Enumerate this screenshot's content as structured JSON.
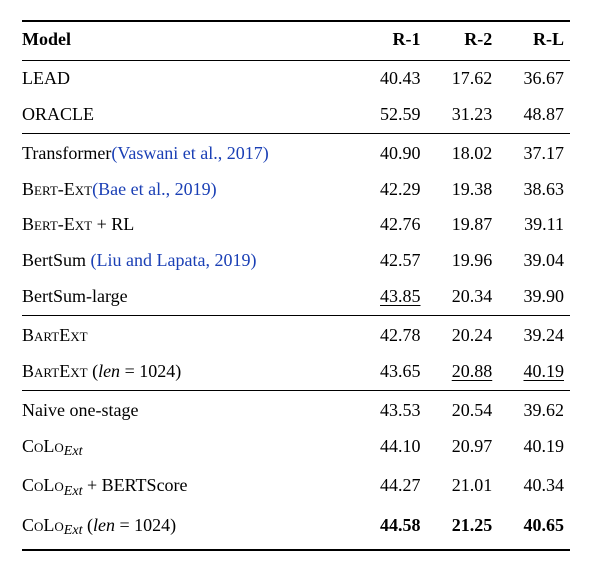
{
  "chart_data": {
    "type": "table",
    "columns": [
      "Model",
      "R-1",
      "R-2",
      "R-L"
    ],
    "sections": [
      {
        "rows": [
          {
            "model_parts": [
              {
                "t": "LEAD"
              }
            ],
            "r1": "40.43",
            "r2": "17.62",
            "rl": "36.67"
          },
          {
            "model_parts": [
              {
                "t": "ORACLE"
              }
            ],
            "r1": "52.59",
            "r2": "31.23",
            "rl": "48.87"
          }
        ]
      },
      {
        "rows": [
          {
            "model_parts": [
              {
                "t": "Transformer"
              },
              {
                "t": "(Vaswani et al., 2017)",
                "cls": "cite"
              }
            ],
            "r1": "40.90",
            "r2": "18.02",
            "rl": "37.17"
          },
          {
            "model_parts": [
              {
                "t": "Bert-Ext",
                "cls": "sc"
              },
              {
                "t": "(Bae et al., 2019)",
                "cls": "cite"
              }
            ],
            "r1": "42.29",
            "r2": "19.38",
            "rl": "38.63"
          },
          {
            "model_parts": [
              {
                "t": "Bert-Ext",
                "cls": "sc"
              },
              {
                "t": " + RL"
              }
            ],
            "r1": "42.76",
            "r2": "19.87",
            "rl": "39.11"
          },
          {
            "model_parts": [
              {
                "t": "BertSum "
              },
              {
                "t": "(Liu and Lapata, 2019)",
                "cls": "cite"
              }
            ],
            "r1": "42.57",
            "r2": "19.96",
            "rl": "39.04"
          },
          {
            "model_parts": [
              {
                "t": "BertSum-large"
              }
            ],
            "r1": "43.85",
            "r1_cls": "ul",
            "r2": "20.34",
            "rl": "39.90"
          }
        ]
      },
      {
        "rows": [
          {
            "model_parts": [
              {
                "t": "BartExt",
                "cls": "sc"
              }
            ],
            "r1": "42.78",
            "r2": "20.24",
            "rl": "39.24"
          },
          {
            "model_parts": [
              {
                "t": "BartExt",
                "cls": "sc"
              },
              {
                "t": " ("
              },
              {
                "t": "len",
                "cls": "ital"
              },
              {
                "t": " = 1024)"
              }
            ],
            "r1": "43.65",
            "r2": "20.88",
            "r2_cls": "ul",
            "rl": "40.19",
            "rl_cls": "ul"
          }
        ]
      },
      {
        "rows": [
          {
            "model_parts": [
              {
                "t": "Naive one-stage"
              }
            ],
            "r1": "43.53",
            "r2": "20.54",
            "rl": "39.62"
          },
          {
            "model_parts": [
              {
                "t": "CoLo",
                "cls": "sc"
              },
              {
                "t": "Ext",
                "cls": "sub"
              }
            ],
            "r1": "44.10",
            "r2": "20.97",
            "rl": "40.19"
          },
          {
            "model_parts": [
              {
                "t": "CoLo",
                "cls": "sc"
              },
              {
                "t": "Ext",
                "cls": "sub"
              },
              {
                "t": " + BERTScore"
              }
            ],
            "r1": "44.27",
            "r2": "21.01",
            "rl": "40.34"
          },
          {
            "model_parts": [
              {
                "t": "CoLo",
                "cls": "sc"
              },
              {
                "t": "Ext",
                "cls": "sub"
              },
              {
                "t": " ("
              },
              {
                "t": "len",
                "cls": "ital"
              },
              {
                "t": " = 1024)"
              }
            ],
            "r1": "44.58",
            "r1_cls": "bold",
            "r2": "21.25",
            "r2_cls": "bold",
            "rl": "40.65",
            "rl_cls": "bold"
          }
        ]
      }
    ]
  },
  "headers": {
    "model": "Model",
    "r1": "R-1",
    "r2": "R-2",
    "rl": "R-L"
  }
}
